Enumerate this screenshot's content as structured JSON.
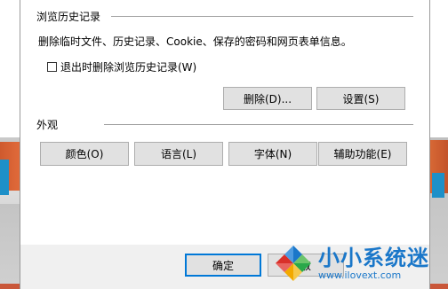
{
  "history": {
    "title": "浏览历史记录",
    "description": "删除临时文件、历史记录、Cookie、保存的密码和网页表单信息。",
    "checkbox_label": "退出时删除浏览历史记录(W)",
    "checkbox_checked": false,
    "delete_label": "删除(D)...",
    "settings_label": "设置(S)"
  },
  "appearance": {
    "title": "外观",
    "colors_label": "颜色(O)",
    "languages_label": "语言(L)",
    "fonts_label": "字体(N)",
    "accessibility_label": "辅助功能(E)"
  },
  "footer": {
    "ok_label": "确定",
    "cancel_label": "取"
  },
  "watermark": {
    "title": "小小系统迷",
    "url": "www.ilovext.com"
  }
}
